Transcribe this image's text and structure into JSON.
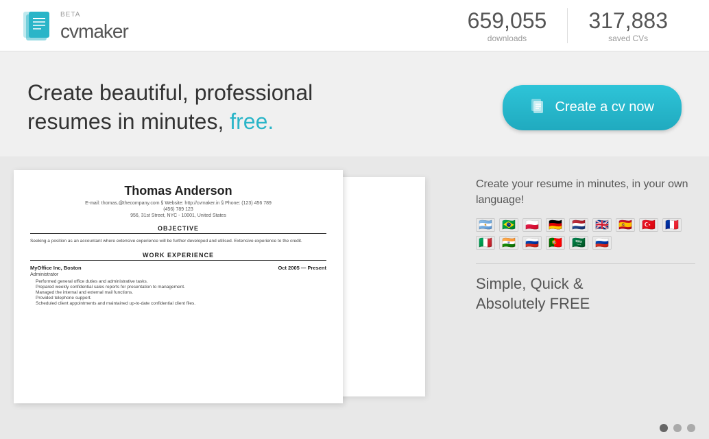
{
  "header": {
    "logo_text": "cvmaker",
    "beta_label": "BETA",
    "stats": [
      {
        "number": "659,055",
        "label": "downloads"
      },
      {
        "number": "317,883",
        "label": "saved CVs"
      }
    ]
  },
  "hero": {
    "headline_part1": "Create beautiful, professional",
    "headline_part2": "resumes in minutes,",
    "headline_free": "free.",
    "cta_button_label": "Create a cv now"
  },
  "resume": {
    "name": "Thomas Anderson",
    "contact": "E-mail: thomas.@thecompany.com   §   Website: http://cvmaker.in   §   Phone: (123) 456 789",
    "phone_line": "(456) 789 123",
    "address": "956, 31st Street, NYC - 10001, United States",
    "objective_heading": "OBJECTIVE",
    "objective_text": "Seeking a position as an accountant where extensive experience will be further developed and utilised. Extensive experience to the credit.",
    "work_heading": "WORK EXPERIENCE",
    "jobs": [
      {
        "company": "MyOffice Inc, Boston",
        "period": "Oct 2005 — Present",
        "title": "Administrator",
        "duties": [
          "Performed general office duties and administrative tasks.",
          "Prepared weekly confidential sales reports for presentation to management.",
          "Managed the internal and external mail functions.",
          "Provided telephone support.",
          "Scheduled client appointments and maintained up-to-date confidential client files."
        ]
      }
    ]
  },
  "right_panel": {
    "language_title": "Create your resume in minutes, in your own language!",
    "flags": [
      "🇦🇷",
      "🇧🇷",
      "🇵🇱",
      "🇩🇪",
      "🇳🇱",
      "🇬🇧",
      "🇪🇸",
      "🇹🇷",
      "🇫🇷",
      "🇮🇹",
      "🇮🇳",
      "🇷🇺",
      "🇵🇹",
      "🇸🇦",
      "🇷🇺"
    ],
    "feature_title": "Simple, Quick &\nAbsolutely FREE"
  },
  "carousel_dots": [
    {
      "active": true
    },
    {
      "active": false
    },
    {
      "active": false
    }
  ]
}
